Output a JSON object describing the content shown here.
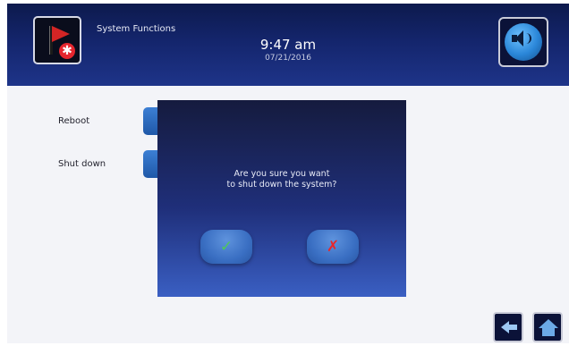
{
  "header": {
    "title": "System Functions",
    "time": "9:47 am",
    "date": "07/21/2016"
  },
  "menu": {
    "items": [
      {
        "label": "Reboot"
      },
      {
        "label": "Shut down"
      }
    ]
  },
  "dialog": {
    "message_line1": "Are you sure you want",
    "message_line2": "to shut down the system?",
    "confirm_glyph": "✓",
    "cancel_glyph": "✗"
  },
  "icons": {
    "flag": "alarm-flag-icon",
    "speaker": "speaker-icon",
    "back": "back-arrow-icon",
    "home": "home-icon",
    "confirm": "checkmark-icon",
    "cancel": "x-icon"
  },
  "colors": {
    "header_dark": "#0d1a4d",
    "dialog_bg": "#1f2f7a",
    "confirm": "#4fc85a",
    "cancel": "#e8262b",
    "flag": "#d32525"
  }
}
